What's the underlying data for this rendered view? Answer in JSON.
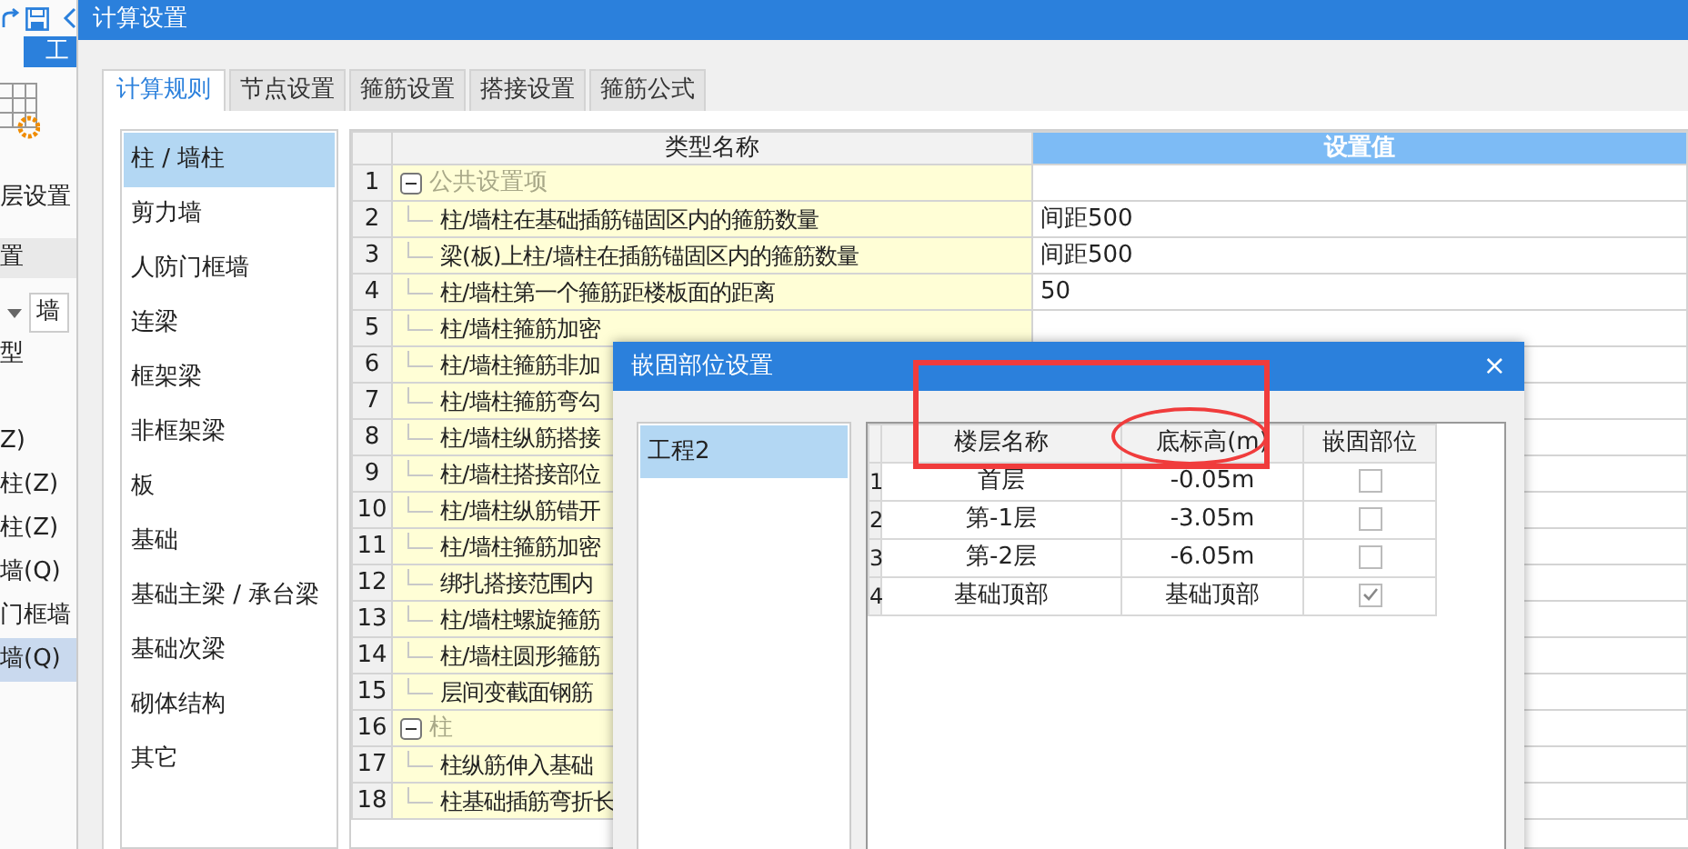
{
  "background_app": {
    "tab_label": "工",
    "toolbar_label": "层设置",
    "section_label": "置",
    "dropdown_value": "墙",
    "list_items": [
      {
        "label": "型",
        "selected": false
      },
      {
        "label": "Z)",
        "selected": false
      },
      {
        "label": "柱(Z)",
        "selected": false
      },
      {
        "label": "柱(Z)",
        "selected": false
      },
      {
        "label": "墙(Q)",
        "selected": false
      },
      {
        "label": "门框墙",
        "selected": false
      },
      {
        "label": "墙(Q)",
        "selected": true
      }
    ]
  },
  "window": {
    "title": "计算设置"
  },
  "tabs": [
    {
      "label": "计算规则",
      "selected": true
    },
    {
      "label": "节点设置",
      "selected": false
    },
    {
      "label": "箍筋设置",
      "selected": false
    },
    {
      "label": "搭接设置",
      "selected": false
    },
    {
      "label": "箍筋公式",
      "selected": false
    }
  ],
  "categories": [
    {
      "label": "柱 / 墙柱",
      "selected": true
    },
    {
      "label": "剪力墙",
      "selected": false
    },
    {
      "label": "人防门框墙",
      "selected": false
    },
    {
      "label": "连梁",
      "selected": false
    },
    {
      "label": "框架梁",
      "selected": false
    },
    {
      "label": "非框架梁",
      "selected": false
    },
    {
      "label": "板",
      "selected": false
    },
    {
      "label": "基础",
      "selected": false
    },
    {
      "label": "基础主梁 / 承台梁",
      "selected": false
    },
    {
      "label": "基础次梁",
      "selected": false
    },
    {
      "label": "砌体结构",
      "selected": false
    },
    {
      "label": "其它",
      "selected": false
    }
  ],
  "settings_table": {
    "columns": [
      "类型名称",
      "设置值"
    ],
    "rows": [
      {
        "number": "1",
        "kind": "group",
        "name": "公共设置项",
        "expanded": true
      },
      {
        "number": "2",
        "kind": "item",
        "name": "柱/墙柱在基础插筋锚固区内的箍筋数量",
        "value": "间距500"
      },
      {
        "number": "3",
        "kind": "item",
        "name": "梁(板)上柱/墙柱在插筋锚固区内的箍筋数量",
        "value": "间距500"
      },
      {
        "number": "4",
        "kind": "item",
        "name": "柱/墙柱第一个箍筋距楼板面的距离",
        "value": "50"
      },
      {
        "number": "5",
        "kind": "item",
        "name": "柱/墙柱箍筋加密"
      },
      {
        "number": "6",
        "kind": "item",
        "name": "柱/墙柱箍筋非加"
      },
      {
        "number": "7",
        "kind": "item",
        "name": "柱/墙柱箍筋弯勾"
      },
      {
        "number": "8",
        "kind": "item",
        "name": "柱/墙柱纵筋搭接"
      },
      {
        "number": "9",
        "kind": "item",
        "name": "柱/墙柱搭接部位"
      },
      {
        "number": "10",
        "kind": "item",
        "name": "柱/墙柱纵筋错开"
      },
      {
        "number": "11",
        "kind": "item",
        "name": "柱/墙柱箍筋加密"
      },
      {
        "number": "12",
        "kind": "item",
        "name": "绑扎搭接范围内"
      },
      {
        "number": "13",
        "kind": "item",
        "name": "柱/墙柱螺旋箍筋"
      },
      {
        "number": "14",
        "kind": "item",
        "name": "柱/墙柱圆形箍筋"
      },
      {
        "number": "15",
        "kind": "item",
        "name": "层间变截面钢筋"
      },
      {
        "number": "16",
        "kind": "group",
        "name": "柱",
        "expanded": true
      },
      {
        "number": "17",
        "kind": "item",
        "name": "柱纵筋伸入基础"
      },
      {
        "number": "18",
        "kind": "item",
        "name": "柱基础插筋弯折长"
      }
    ]
  },
  "dialog": {
    "title": "嵌固部位设置",
    "close": "×",
    "projects": [
      {
        "label": "工程2",
        "selected": true
      }
    ],
    "columns": [
      "楼层名称",
      "底标高(m)",
      "嵌固部位"
    ],
    "rows": [
      {
        "number": "1",
        "floor": "首层",
        "elevation": "-0.05m",
        "checked": false
      },
      {
        "number": "2",
        "floor": "第-1层",
        "elevation": "-3.05m",
        "checked": false
      },
      {
        "number": "3",
        "floor": "第-2层",
        "elevation": "-6.05m",
        "checked": false
      },
      {
        "number": "4",
        "floor": "基础顶部",
        "elevation": "基础顶部",
        "checked": true
      }
    ]
  },
  "annotations": [
    {
      "kind": "rectangle"
    },
    {
      "kind": "ellipse"
    }
  ]
}
